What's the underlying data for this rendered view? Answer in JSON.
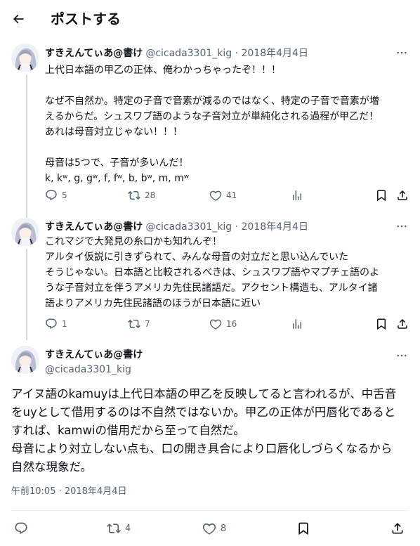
{
  "header": {
    "title": "ポストする"
  },
  "replies": [
    {
      "name": "すきえんてぃあ@書け",
      "meta": "@cicada3301_kig · 2018年4月4日",
      "text": "上代日本語の甲乙の正体、俺わかっちゃったぞ！！！\n\nなぜ不自然か。特定の子音で音素が減るのではなく、特定の子音で音素が増\nえるからだ。シュスワプ語のような子音対立が単純化される過程が甲乙だ！\nあれは母音対立じゃない！！！\n\n母音は5つで、子音が多いんだ！\nk, kʷ, g, gʷ, f, fʷ, b, bʷ, m, mʷ",
      "replies": "5",
      "reposts": "28",
      "likes": "41"
    },
    {
      "name": "すきえんてぃあ@書け",
      "meta": "@cicada3301_kig · 2018年4月4日",
      "text": "これマジで大発見の糸口かも知れんぞ！\nアルタイ仮説に引きずられて、みんな母音の対立だと思い込んでいた\nそうじゃない。日本語と比較されるべきは、シュスワプ語やマプチェ語のよ\nうな子音対立を伴うアメリカ先住民諸語だ。アクセント構造も、アルタイ諸\n語よりアメリカ先住民諸語のほうが日本語に近い",
      "replies": "1",
      "reposts": "7",
      "likes": "16"
    }
  ],
  "main": {
    "name": "すきえんてぃあ@書け",
    "handle": "@cicada3301_kig",
    "text": "アイヌ語のkamuyは上代日本語の甲乙を反映してると言われるが、中舌音\nをuyとして借用するのは不自然ではないか。甲乙の正体が円唇化であると\nすれば、kamwiの借用だから至って自然だ。\n母音により対立しない点も、口の開き具合により口唇化しづらくなるから\n自然な現象だ。",
    "time": "午前10:05 · 2018年4月4日",
    "reposts": "4",
    "likes": "8"
  },
  "icons": {
    "back": "arrow-left-icon",
    "more": "more-horizontal-icon",
    "reply": "reply-bubble-icon",
    "repost": "repost-arrows-icon",
    "like": "heart-icon",
    "views": "bar-chart-icon",
    "bookmark": "bookmark-icon",
    "share": "share-upload-icon"
  },
  "colors": {
    "text": "#0f1419",
    "secondary": "#536471",
    "line": "#cfd9de"
  }
}
